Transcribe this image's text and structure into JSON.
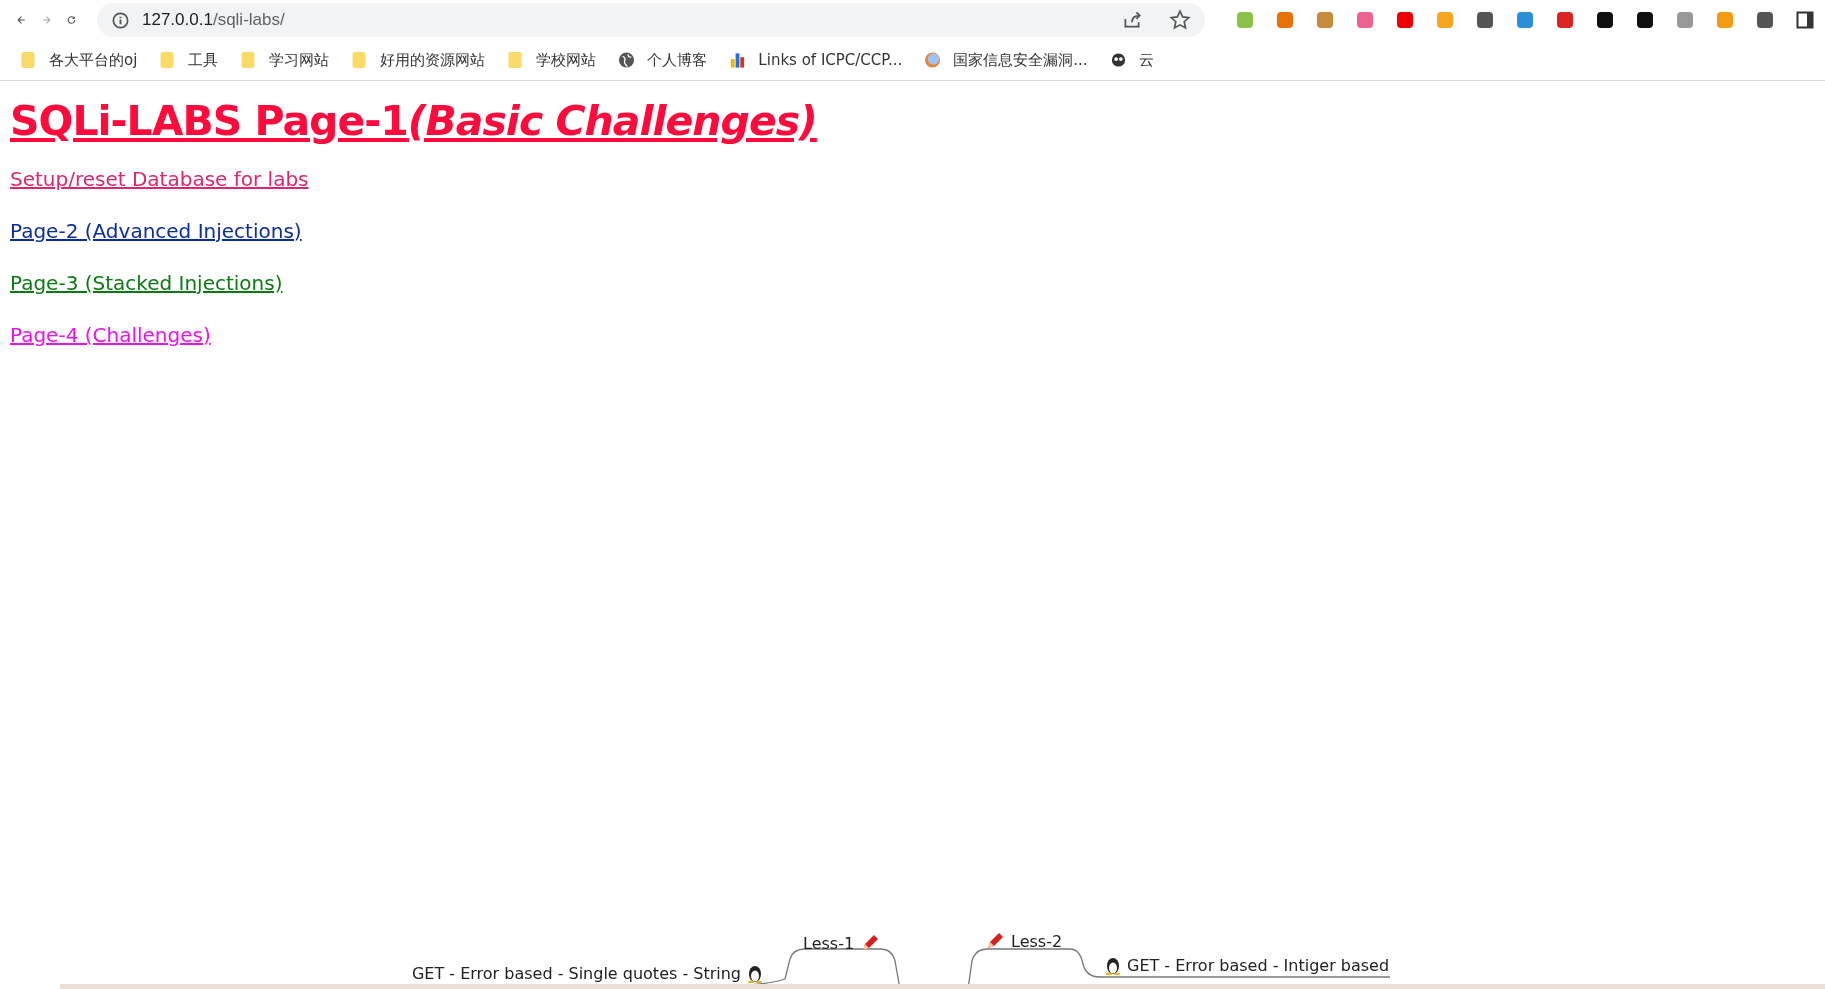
{
  "toolbar": {
    "url_host": "127.0.0.1",
    "url_path": "/sqli-labs/"
  },
  "bookmarks": [
    {
      "label": "各大平台的oj",
      "kind": "folder"
    },
    {
      "label": "工具",
      "kind": "folder"
    },
    {
      "label": "学习网站",
      "kind": "folder"
    },
    {
      "label": "好用的资源网站",
      "kind": "folder"
    },
    {
      "label": "学校网站",
      "kind": "folder"
    },
    {
      "label": "个人博客",
      "kind": "globe"
    },
    {
      "label": "Links of ICPC/CCP...",
      "kind": "chart"
    },
    {
      "label": "国家信息安全漏洞...",
      "kind": "site"
    },
    {
      "label": "云",
      "kind": "mascot"
    }
  ],
  "page": {
    "title": {
      "main": "SQLi-LABS Page-1",
      "italic_part": "(Basic Challenges)"
    },
    "links": [
      {
        "label": "Setup/reset Database for labs",
        "color": "#e0256f"
      },
      {
        "label": "Page-2 (Advanced Injections)",
        "color": "#0a2ea0"
      },
      {
        "label": "Page-3 (Stacked Injections)",
        "color": "#0a7a12"
      },
      {
        "label": "Page-4 (Challenges)",
        "color": "#ee10ee"
      }
    ]
  },
  "mind_map": {
    "lessons": [
      {
        "name": "Less-1",
        "description": "GET - Error based - Single quotes - String"
      },
      {
        "name": "Less-2",
        "description": "GET - Error based - Intiger based"
      }
    ]
  }
}
